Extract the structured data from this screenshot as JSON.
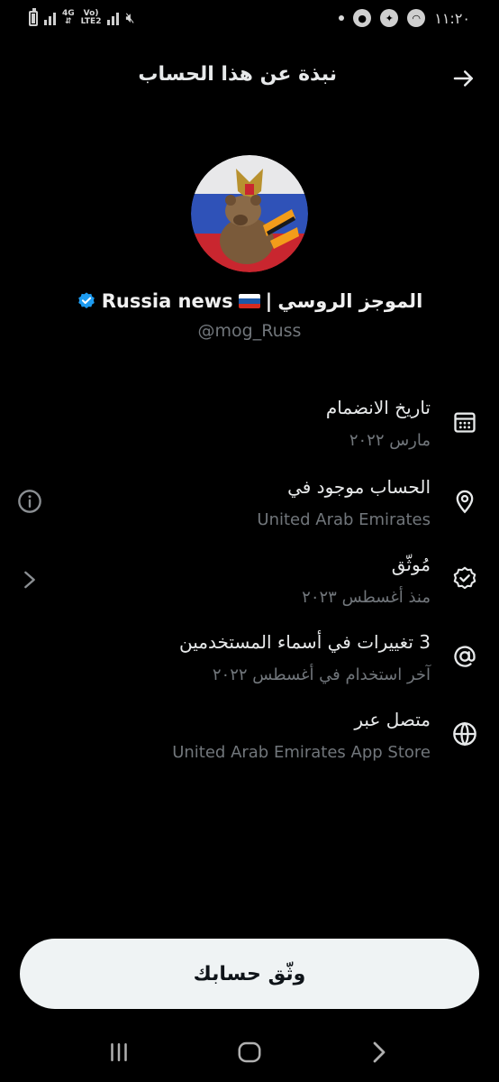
{
  "status_bar": {
    "network": "4G",
    "volte": "Vo)",
    "lte": "LTE2",
    "time": "١١:٢٠"
  },
  "header": {
    "title": "نبذة عن هذا الحساب"
  },
  "profile": {
    "display_name_ar": "الموجز الروسي",
    "separator": "|",
    "display_name_en": "Russia news",
    "handle": "@mog_Russ"
  },
  "info": {
    "joined": {
      "title": "تاريخ الانضمام",
      "value": "مارس ٢٠٢٢"
    },
    "location": {
      "title": "الحساب موجود في",
      "value": "United Arab Emirates"
    },
    "verified": {
      "title": "مُوثّق",
      "value": "منذ أغسطس ٢٠٢٣"
    },
    "username_changes": {
      "title": "3 تغييرات في أسماء المستخدمين",
      "value": "آخر استخدام في أغسطس ٢٠٢٢"
    },
    "connected_via": {
      "title": "متصل عبر",
      "value": "United Arab Emirates App Store"
    }
  },
  "verify_button": {
    "label": "وثّق حسابك"
  },
  "colors": {
    "background": "#000000",
    "text_primary": "#e7e9ea",
    "text_secondary": "#71767b",
    "verified_badge": "#1d9bf0",
    "button_bg": "#eff3f4"
  },
  "icons": {
    "back": "arrow-right-icon",
    "joined": "calendar-icon",
    "location": "location-pin-icon",
    "verified": "verified-badge-icon",
    "username": "at-sign-icon",
    "connected": "globe-icon",
    "side_info": "info-icon",
    "side_chevron": "chevron-right-icon"
  }
}
